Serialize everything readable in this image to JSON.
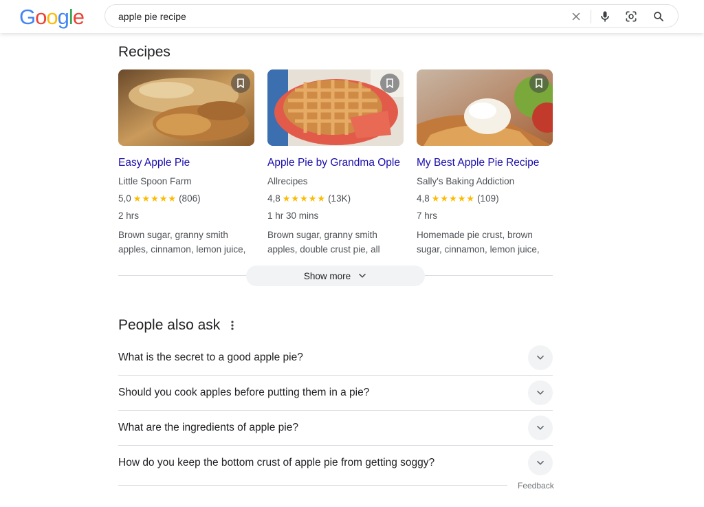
{
  "header": {
    "logo_letters": [
      "G",
      "o",
      "o",
      "g",
      "l",
      "e"
    ],
    "logo_colors": [
      "#4285F4",
      "#EA4335",
      "#FBBC05",
      "#4285F4",
      "#34A853",
      "#EA4335"
    ],
    "search_value": "apple pie recipe",
    "icons": [
      "close-icon",
      "mic-icon",
      "lens-icon",
      "search-icon"
    ]
  },
  "recipes": {
    "title": "Recipes",
    "cards": [
      {
        "title": "Easy Apple Pie",
        "source": "Little Spoon Farm",
        "rating": "5,0",
        "stars": "★★★★★",
        "reviews": "(806)",
        "time": "2 hrs",
        "ingredients_line1": "Brown sugar, granny smith",
        "ingredients_line2": "apples, cinnamon, lemon juice,"
      },
      {
        "title": "Apple Pie by Grandma Ople",
        "source": "Allrecipes",
        "rating": "4,8",
        "stars": "★★★★★",
        "reviews": "(13K)",
        "time": "1 hr 30 mins",
        "ingredients_line1": "Brown sugar, granny smith",
        "ingredients_line2": "apples, double crust pie, all"
      },
      {
        "title": "My Best Apple Pie Recipe",
        "source": "Sally's Baking Addiction",
        "rating": "4,8",
        "stars": "★★★★★",
        "reviews": "(109)",
        "time": "7 hrs",
        "ingredients_line1": "Homemade pie crust, brown",
        "ingredients_line2": "sugar, cinnamon, lemon juice,"
      }
    ],
    "show_more": "Show more"
  },
  "people_also_ask": {
    "title": "People also ask",
    "questions": [
      "What is the secret to a good apple pie?",
      "Should you cook apples before putting them in a pie?",
      "What are the ingredients of apple pie?",
      "How do you keep the bottom crust of apple pie from getting soggy?"
    ],
    "feedback": "Feedback"
  },
  "colors": {
    "link": "#1a0dab",
    "star": "#fbbc04",
    "secondary_text": "#4d5156"
  }
}
